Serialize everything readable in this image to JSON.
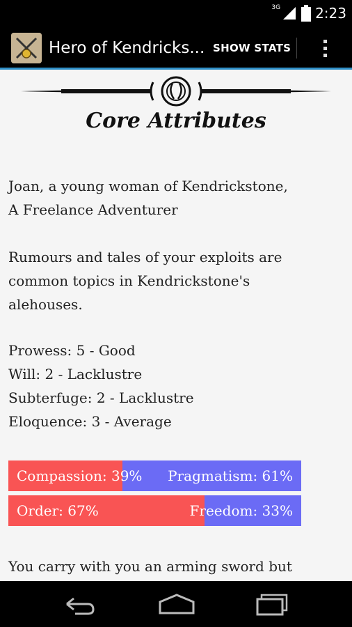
{
  "status_bar": {
    "network": "3G",
    "time": "2:23",
    "icons": [
      "signal-icon",
      "battery-icon"
    ]
  },
  "action_bar": {
    "title": "Hero of Kendricks...",
    "show_stats": "SHOW STATS",
    "overflow_icon": "overflow-menu-icon"
  },
  "content": {
    "title": "Core Attributes",
    "intro_lines": [
      "Joan, a young woman of Kendrickstone,",
      "A Freelance Adventurer"
    ],
    "rumour_lines": [
      "Rumours and tales of your exploits are",
      "common topics in Kendrickstone's",
      "alehouses."
    ],
    "stats": [
      "Prowess: 5 - Good",
      "Will: 2 - Lacklustre",
      "Subterfuge: 2 - Lacklustre",
      "Eloquence: 3 - Average"
    ],
    "bars": [
      {
        "left_label": "Compassion: 39%",
        "right_label": "Pragmatism: 61%",
        "left_percent": 39
      },
      {
        "left_label": "Order: 67%",
        "right_label": "Freedom: 33%",
        "left_percent": 67
      }
    ],
    "trailing_line": "You carry with you an arming sword but"
  },
  "colors": {
    "bar_left": "#f95454",
    "bar_right": "#6b6bf5",
    "accent_line": "#2e8fc7"
  },
  "nav_bar": {
    "icons": [
      "back-icon",
      "home-icon",
      "recent-apps-icon"
    ]
  }
}
